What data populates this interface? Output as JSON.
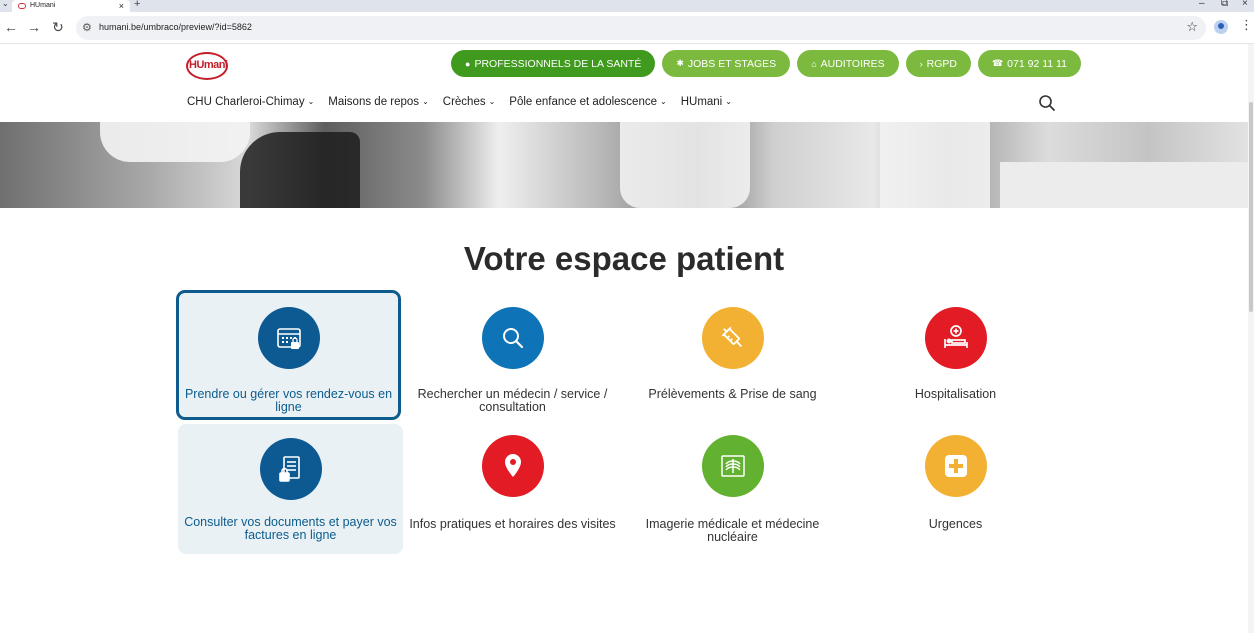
{
  "browser": {
    "tab_title": "HUmani",
    "url": "humani.be/umbraco/preview/?id=5862"
  },
  "site": {
    "logo_text": "HUmani",
    "top_buttons": [
      {
        "label": "PROFESSIONNELS DE LA SANTÉ",
        "icon": "user-icon"
      },
      {
        "label": "JOBS ET STAGES",
        "icon": "person-icon"
      },
      {
        "label": "AUDITOIRES",
        "icon": "home-icon"
      },
      {
        "label": "RGPD",
        "icon": "chevron-right-icon"
      },
      {
        "label": "071 92 11 11",
        "icon": "phone-icon"
      }
    ],
    "nav": [
      {
        "label": "CHU Charleroi-Chimay"
      },
      {
        "label": "Maisons de repos"
      },
      {
        "label": "Crèches"
      },
      {
        "label": "Pôle enfance et adolescence"
      },
      {
        "label": "HUmani"
      }
    ]
  },
  "main": {
    "title": "Votre espace patient",
    "cards": [
      {
        "label": "Prendre ou gérer vos rendez-vous en ligne",
        "icon": "calendar-lock-icon",
        "color": "#0d5a92"
      },
      {
        "label": "Rechercher un médecin / service / consultation",
        "icon": "search-icon",
        "color": "#0e73b7"
      },
      {
        "label": "Prélèvements & Prise de sang",
        "icon": "syringe-icon",
        "color": "#f2b132"
      },
      {
        "label": "Hospitalisation",
        "icon": "hospital-bed-icon",
        "color": "#e21b24"
      },
      {
        "label": "Consulter vos documents et payer vos factures en ligne",
        "icon": "document-lock-icon",
        "color": "#0d5a92"
      },
      {
        "label": "Infos pratiques et horaires des visites",
        "icon": "map-pin-icon",
        "color": "#e21b24"
      },
      {
        "label": "Imagerie médicale et médecine nucléaire",
        "icon": "xray-icon",
        "color": "#63b130"
      },
      {
        "label": "Urgences",
        "icon": "first-aid-icon",
        "color": "#f2b132"
      }
    ]
  }
}
